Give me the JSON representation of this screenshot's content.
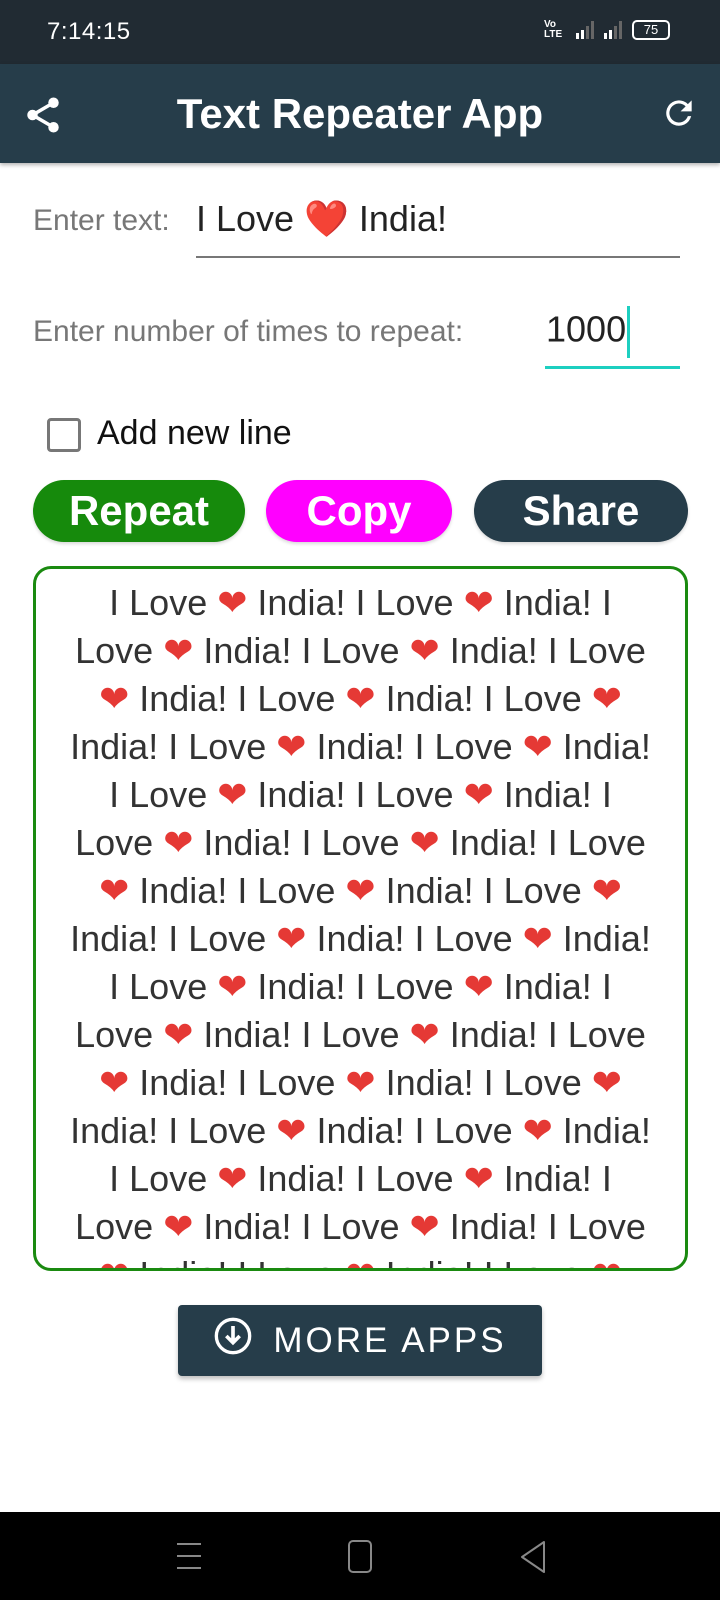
{
  "status_bar": {
    "time": "7:14:15",
    "network": "Vo LTE",
    "battery": "75"
  },
  "app_bar": {
    "title": "Text Repeater App",
    "share_icon": "share-icon",
    "refresh_icon": "refresh-icon"
  },
  "form": {
    "text_label": "Enter text:",
    "text_value": "I Love ❤️ India!",
    "count_label": "Enter number of times to repeat:",
    "count_value": "1000",
    "newline_label": "Add new line",
    "newline_checked": false
  },
  "buttons": {
    "repeat": "Repeat",
    "copy": "Copy",
    "share": "Share"
  },
  "colors": {
    "repeat": "#168a0c",
    "copy": "#ff00ff",
    "share": "#263d4a",
    "accent": "#1dcfc0"
  },
  "more_apps": {
    "label": "MORE APPS",
    "icon": "download-circle-icon"
  }
}
